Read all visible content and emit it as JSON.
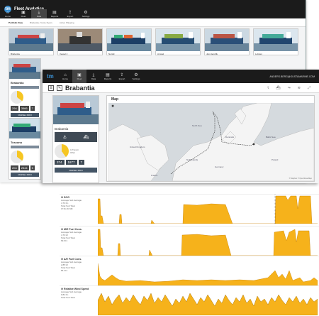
{
  "app": {
    "title": "Fleet Analytics",
    "logo_text": "tm"
  },
  "back_window": {
    "nav": [
      {
        "label": "Home",
        "icon": "home-icon",
        "glyph": "⌂"
      },
      {
        "label": "Fleet",
        "icon": "ship-icon",
        "glyph": "▣"
      },
      {
        "label": "Data",
        "icon": "download-icon",
        "glyph": "⤓"
      },
      {
        "label": "Reports",
        "icon": "document-icon",
        "glyph": "▤"
      },
      {
        "label": "Export",
        "icon": "upload-icon",
        "glyph": "⇪"
      },
      {
        "label": "Settings",
        "icon": "gear-icon",
        "glyph": "⚙"
      }
    ],
    "tabs": [
      "Portfolio View",
      "Brabantia / Grote Flyers",
      "Active Shipping"
    ],
    "thumbnails": [
      "Brabantia",
      "Vessel 2",
      "Nordic",
      "Amstel",
      "Jan Hendrik",
      "Lofoten"
    ],
    "cards": [
      {
        "title": "Brabantia",
        "stats": [
          "294",
          "3566",
          "7"
        ],
        "button": "VESSEL INFO"
      },
      {
        "title": "Toscana",
        "stats": [
          "204",
          "2544",
          "5"
        ],
        "button": "VESSEL INFO"
      }
    ]
  },
  "front_window": {
    "user_email": "ANDERS.BERG@GUSTAMARINE.COM",
    "vessel_name": "Brabantia",
    "map_title": "Map",
    "map_attribution": "© Mapbox © OpenStreetMap",
    "map_labels": [
      "North Sea",
      "United Kingdom",
      "Netherlands",
      "Germany",
      "Poland",
      "Denmark",
      "France",
      "Baltic Sea"
    ],
    "left_panel": {
      "title": "Brabantia",
      "legend": [
        "In Transit",
        "Other"
      ],
      "stats": [
        "374",
        "1877",
        "7"
      ],
      "button": "VESSEL INFO"
    }
  },
  "charts": [
    {
      "title": "SOG",
      "sub": [
        "Average   Sub Average",
        "4.73 Kn",
        "Total   Sub Total",
        "1716.16 NM"
      ]
    },
    {
      "title": "M/E Fuel Cons.",
      "sub": [
        "Average   Sub Average",
        "4.73 t/h",
        "Total   Sub Total",
        "69.94 t"
      ]
    },
    {
      "title": "A/E Fuel Cons.",
      "sub": [
        "Average   Sub Average",
        "2.85 t/h",
        "Total   Sub Total",
        "84.44 t"
      ]
    },
    {
      "title": "Relative Wind Speed",
      "sub": [
        "Average   Sub Average",
        "9.84 Kn",
        "Total   Sub Total"
      ]
    }
  ],
  "colors": {
    "accent": "#f6c623",
    "nav_bg": "#1b1b1b",
    "panel_dark": "#3f4a55"
  }
}
